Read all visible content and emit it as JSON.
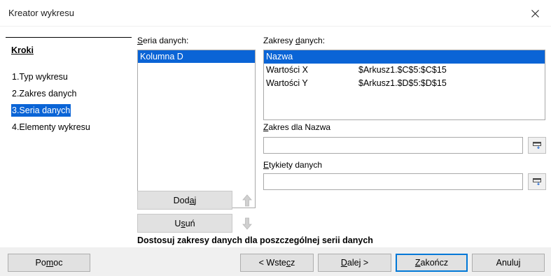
{
  "window": {
    "title": "Kreator wykresu"
  },
  "steps": {
    "heading": "Kroki",
    "items": [
      {
        "label": "1.Typ wykresu"
      },
      {
        "label": "2.Zakres danych"
      },
      {
        "label": "3.Seria danych"
      },
      {
        "label": "4.Elementy wykresu"
      }
    ],
    "active_index": 2
  },
  "series": {
    "label_prefix": "S",
    "label_rest": "eria danych:",
    "items": [
      {
        "label": "Kolumna D"
      }
    ],
    "add": {
      "pre": "Dod",
      "key": "a",
      "post": "j"
    },
    "remove": {
      "pre": "U",
      "key": "s",
      "post": "uń"
    }
  },
  "ranges": {
    "label_pre": "Zakresy ",
    "label_key": "d",
    "label_post": "anych:",
    "rows": [
      {
        "name": "Nazwa",
        "value": ""
      },
      {
        "name": "Wartości X",
        "value": "$Arkusz1.$C$5:$C$15"
      },
      {
        "name": "Wartości Y",
        "value": "$Arkusz1.$D$5:$D$15"
      }
    ]
  },
  "range_for_name": {
    "label_key": "Z",
    "label_rest": "akres dla Nazwa",
    "value": ""
  },
  "data_labels": {
    "label_key": "E",
    "label_rest": "tykiety danych",
    "value": ""
  },
  "hint": "Dostosuj zakresy danych dla poszczególnej serii danych",
  "footer": {
    "help": {
      "pre": "Po",
      "key": "m",
      "post": "oc"
    },
    "back": {
      "pre": "< Wste",
      "key": "c",
      "post": "z"
    },
    "next": {
      "pre": "",
      "key": "D",
      "post": "alej >"
    },
    "finish": {
      "pre": "",
      "key": "Z",
      "post": "akończ"
    },
    "cancel": {
      "pre": "Anuluj",
      "key": "",
      "post": ""
    }
  },
  "colors": {
    "selection": "#0a64d6",
    "footer_bg": "#f0f0f0",
    "button_bg": "#e1e1e1",
    "default_border": "#0078d7"
  }
}
